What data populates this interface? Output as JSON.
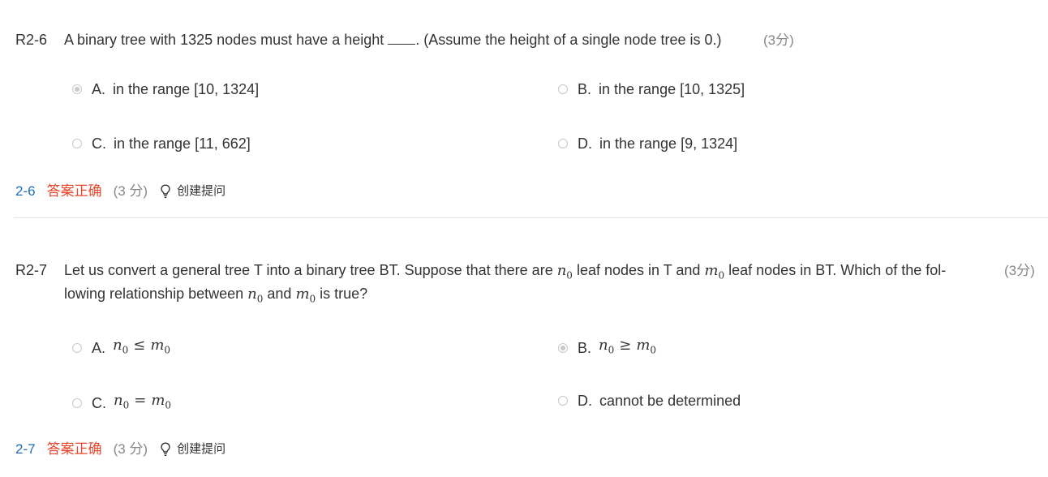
{
  "questions": [
    {
      "id": "R2-6",
      "text_before": "A binary tree with 1325 nodes must have a height ",
      "text_after": ". (Assume the height of a single node tree is 0.)",
      "score": "(3分)",
      "options": [
        {
          "letter": "A.",
          "text": "in the range [10, 1324]",
          "selected": true
        },
        {
          "letter": "B.",
          "text": "in the range [10, 1325]",
          "selected": false
        },
        {
          "letter": "C.",
          "text": "in the range [11, 662]",
          "selected": false
        },
        {
          "letter": "D.",
          "text": "in the range [9, 1324]",
          "selected": false
        }
      ],
      "result": {
        "number": "2-6",
        "status": "答案正确",
        "points": "(3 分)",
        "hint": "创建提问"
      }
    },
    {
      "id": "R2-7",
      "line1_a": "Let us convert a general tree T into a binary tree BT. Suppose that there are ",
      "line1_b": " leaf nodes in T and ",
      "line1_c": " leaf nodes in BT. Which of the fol-",
      "line2_a": "lowing relationship between ",
      "line2_b": " and ",
      "line2_c": " is true?",
      "var_n": "n",
      "var_m": "m",
      "sub": "0",
      "score": "(3分)",
      "options": [
        {
          "letter": "A.",
          "op": "≤",
          "selected": false
        },
        {
          "letter": "B.",
          "op": "≥",
          "selected": true
        },
        {
          "letter": "C.",
          "op": "=",
          "selected": false
        },
        {
          "letter": "D.",
          "text": "cannot be determined",
          "selected": false
        }
      ],
      "result": {
        "number": "2-7",
        "status": "答案正确",
        "points": "(3 分)",
        "hint": "创建提问"
      }
    }
  ],
  "icons": {
    "hint": "lightbulb-icon"
  },
  "colors": {
    "status_correct": "#e8452c",
    "question_number": "#1e6fb8",
    "radio_border": "#c8c8c8"
  }
}
